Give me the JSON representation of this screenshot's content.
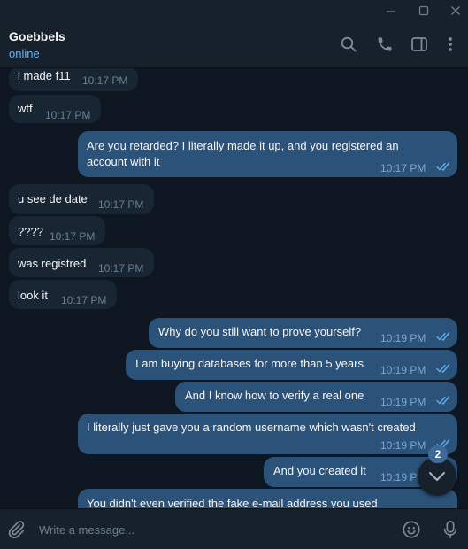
{
  "header": {
    "peer_name": "Goebbels",
    "status": "online"
  },
  "composer": {
    "placeholder": "Write a message..."
  },
  "scroll": {
    "unread_count": "2"
  },
  "messages": [
    {
      "dir": "in",
      "text": "i made f11",
      "time": "10:17 PM"
    },
    {
      "dir": "in",
      "text": "wtf",
      "time": "10:17 PM"
    },
    {
      "dir": "out",
      "lines": [
        "Are you retarded? I literally made it up, and you registered an",
        "account with it"
      ],
      "time": "10:17 PM",
      "read": true
    },
    {
      "dir": "in",
      "text": "u see de date",
      "time": "10:17 PM"
    },
    {
      "dir": "in",
      "text": "????",
      "time": "10:17 PM"
    },
    {
      "dir": "in",
      "text": "was registred",
      "time": "10:17 PM"
    },
    {
      "dir": "in",
      "text": "look it",
      "time": "10:17 PM"
    },
    {
      "dir": "out",
      "text": "Why do you still want to prove yourself?",
      "time": "10:19 PM",
      "read": true
    },
    {
      "dir": "out",
      "text": "I am buying databases for more than 5 years",
      "time": "10:19 PM",
      "read": true
    },
    {
      "dir": "out",
      "text": "And I know how to verify a real one",
      "time": "10:19 PM",
      "read": true
    },
    {
      "dir": "out",
      "text": "I literally just gave you a random username which wasn't created",
      "time": "10:19 PM",
      "read": true
    },
    {
      "dir": "out",
      "text": "And you created it",
      "time": "10:19 PM",
      "read": true
    },
    {
      "dir": "out",
      "text": "You didn't even verified the fake e-mail address you used",
      "time": "",
      "read": false
    }
  ],
  "colors": {
    "chat_bg": "#0e1621",
    "panel_bg": "#17212b",
    "incoming_bubble": "#182533",
    "outgoing_bubble": "#2b5278",
    "accent": "#6ab3f3"
  }
}
